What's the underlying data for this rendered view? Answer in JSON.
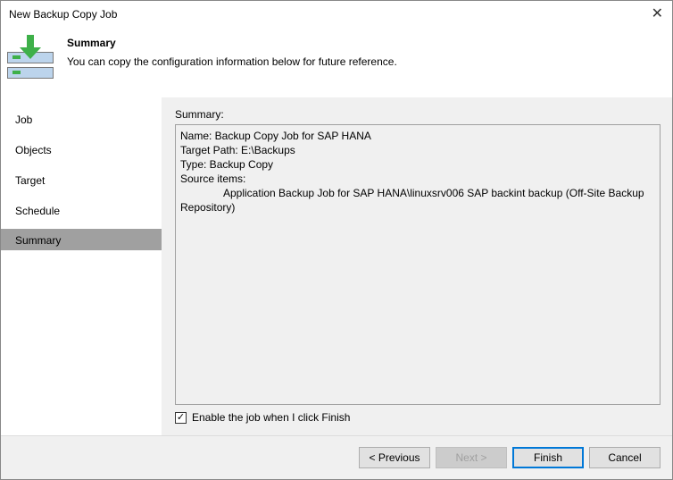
{
  "window": {
    "title": "New Backup Copy Job",
    "close": "✕"
  },
  "header": {
    "title": "Summary",
    "description": "You can copy the configuration information below for future reference."
  },
  "sidebar": {
    "items": [
      {
        "label": "Job"
      },
      {
        "label": "Objects"
      },
      {
        "label": "Target"
      },
      {
        "label": "Schedule"
      },
      {
        "label": "Summary",
        "active": true
      }
    ]
  },
  "main": {
    "label": "Summary:",
    "lines": [
      "Name: Backup Copy Job for SAP HANA",
      "Target Path: E:\\Backups",
      "Type: Backup Copy",
      "Source items:"
    ],
    "source_item": "Application Backup Job for SAP HANA\\linuxsrv006 SAP backint backup (Off-Site Backup Repository)",
    "enable_label": "Enable the job when I click Finish",
    "enable_checked": true
  },
  "buttons": {
    "previous": "< Previous",
    "next": "Next >",
    "finish": "Finish",
    "cancel": "Cancel"
  }
}
